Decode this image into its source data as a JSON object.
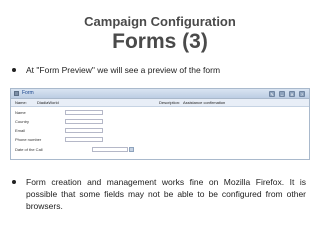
{
  "slide": {
    "heading": "Campaign Configuration",
    "title": "Forms (3)"
  },
  "bullets": [
    "At \"Form Preview\" we will see a preview of the form",
    "Form creation and management works fine on Mozilla Firefox. It is possible that some fields may not be able to be configured from other browsers."
  ],
  "form_preview": {
    "window_title": "Form",
    "toolbar": {
      "name_label": "Name:",
      "name_value": "DiadiaWorld",
      "description_label": "Description:",
      "description_value": "Assistance confirmation"
    },
    "fields": [
      {
        "label": "Name"
      },
      {
        "label": "Country"
      },
      {
        "label": "Email"
      },
      {
        "label": "Phone number"
      },
      {
        "label": "Date of the Call"
      }
    ],
    "title_tools": [
      "edit-icon",
      "move-icon",
      "close-icon",
      "help-icon"
    ]
  }
}
